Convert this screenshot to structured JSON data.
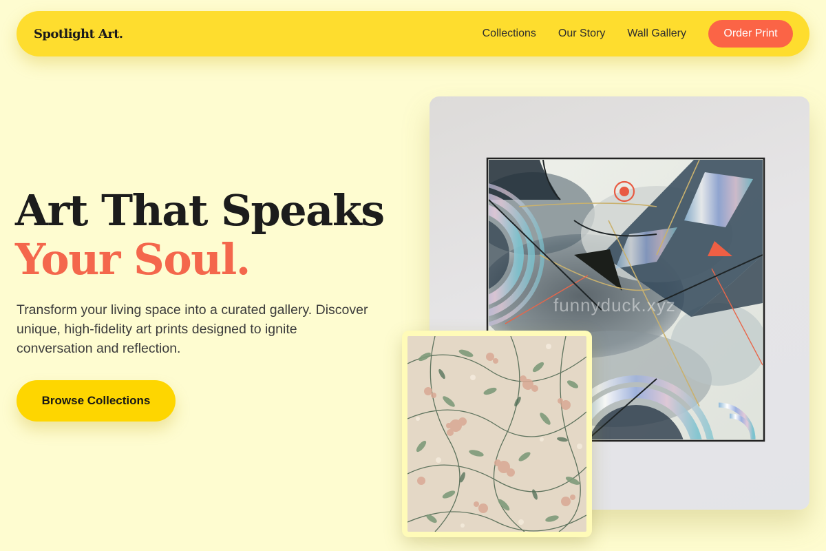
{
  "brand": {
    "logo": "Spotlight Art."
  },
  "nav": {
    "links": [
      "Collections",
      "Our Story",
      "Wall Gallery"
    ],
    "cta": "Order Print"
  },
  "hero": {
    "title_line1": "Art That Speaks",
    "title_line2": "Your Soul.",
    "description": "Transform your living space into a curated gallery. Discover unique, high-fidelity art prints designed to ignite conversation and reflection.",
    "button": "Browse Collections"
  },
  "artwork": {
    "watermark": "funnyduck.xyz"
  },
  "colors": {
    "background": "#fefcd0",
    "nav_yellow": "#fedd2e",
    "accent_coral": "#f4674c",
    "button_yellow": "#fed600"
  }
}
